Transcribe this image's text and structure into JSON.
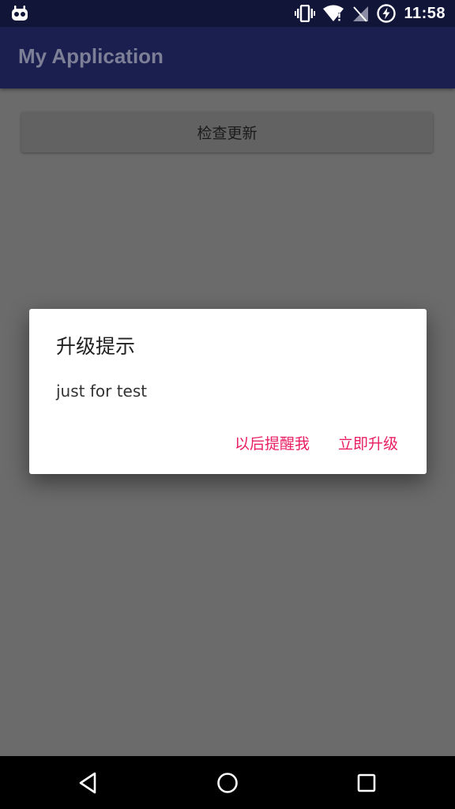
{
  "status_bar": {
    "time": "11:58",
    "icons": [
      "android-debug-icon",
      "vibrate-icon",
      "wifi-icon",
      "no-signal-icon",
      "battery-charging-icon"
    ]
  },
  "app_bar": {
    "title": "My Application"
  },
  "content": {
    "check_update_label": "检查更新"
  },
  "dialog": {
    "title": "升级提示",
    "message": "just for test",
    "later_label": "以后提醒我",
    "upgrade_label": "立即升级"
  },
  "nav_bar": {
    "icons": [
      "back-icon",
      "home-icon",
      "recents-icon"
    ]
  },
  "colors": {
    "status_bar": "#111639",
    "app_bar": "#1a1f4f",
    "accent": "#e91e63",
    "scrim_background": "#6b6b6b"
  }
}
